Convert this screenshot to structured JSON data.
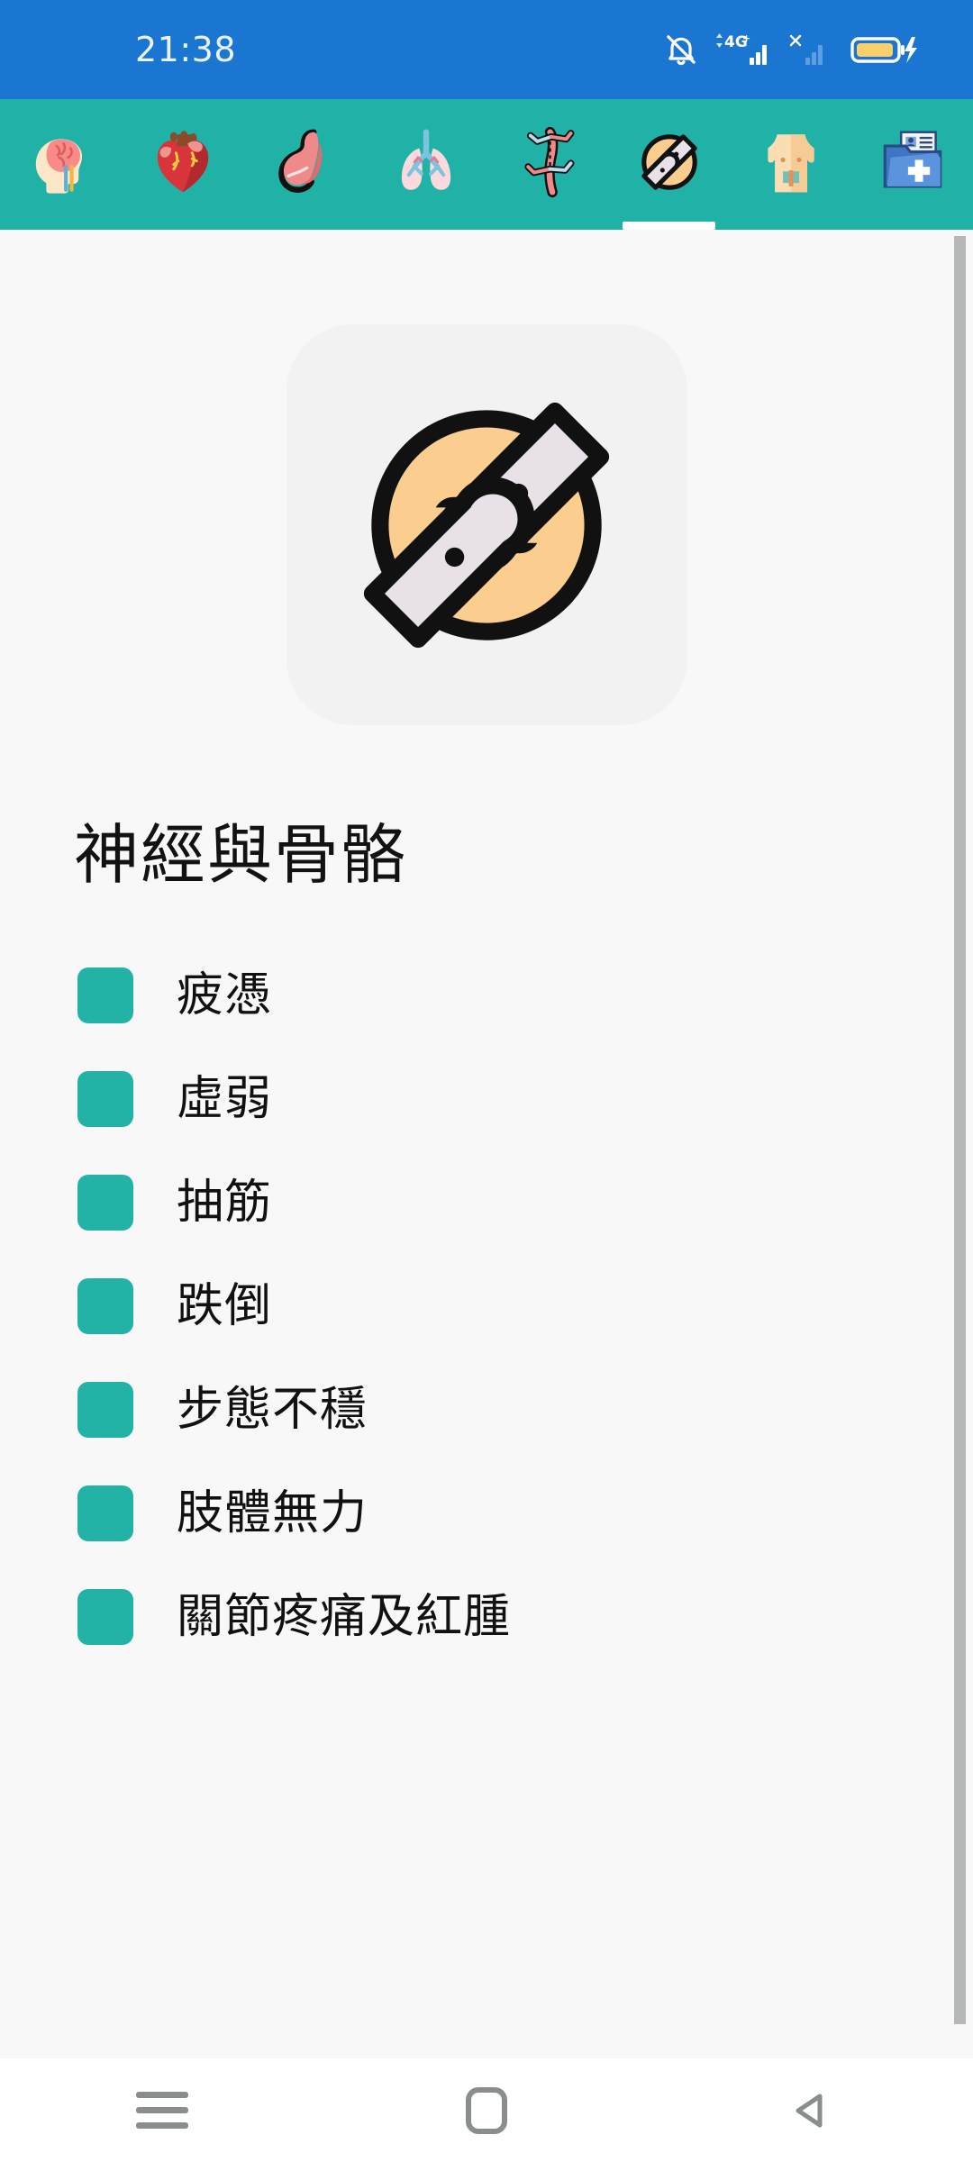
{
  "status_bar": {
    "time": "21:38",
    "icons": [
      {
        "name": "bell-muted-icon"
      },
      {
        "name": "signal-4g-plus-icon",
        "label": "4G+"
      },
      {
        "name": "signal-no-service-icon",
        "label": "×"
      },
      {
        "name": "battery-charging-icon"
      }
    ],
    "background_color": "#1b76d2"
  },
  "tabs": {
    "accent_color": "#20b2a6",
    "active_index": 5,
    "items": [
      {
        "name": "tab-brain-nerves",
        "icon": "head-brain-icon"
      },
      {
        "name": "tab-heart",
        "icon": "heart-icon"
      },
      {
        "name": "tab-stomach",
        "icon": "stomach-icon"
      },
      {
        "name": "tab-lungs",
        "icon": "lungs-icon"
      },
      {
        "name": "tab-blood-vessels",
        "icon": "blood-vessel-icon"
      },
      {
        "name": "tab-bones-joints",
        "icon": "bone-joint-icon"
      },
      {
        "name": "tab-torso-body",
        "icon": "torso-icon"
      },
      {
        "name": "tab-medical-records",
        "icon": "medical-folder-icon"
      }
    ]
  },
  "main": {
    "hero_icon": "bone-joint-icon",
    "hero_card_color": "#f2f2f2",
    "hero_circle_color": "#fbcd8e",
    "hero_bone_color": "#e8e2e8",
    "title": "神經與骨骼",
    "checkbox_color": "#22b3a6",
    "symptoms": [
      {
        "label": "疲憑"
      },
      {
        "label": "虛弱"
      },
      {
        "label": "抽筋"
      },
      {
        "label": "跌倒"
      },
      {
        "label": "步態不穩"
      },
      {
        "label": "肢體無力"
      },
      {
        "label": "關節疼痛及紅腫"
      }
    ]
  },
  "nav_bar": {
    "buttons": [
      {
        "name": "nav-recents-button",
        "icon": "menu-lines-icon"
      },
      {
        "name": "nav-home-button",
        "icon": "home-square-icon"
      },
      {
        "name": "nav-back-button",
        "icon": "back-triangle-icon"
      }
    ]
  }
}
